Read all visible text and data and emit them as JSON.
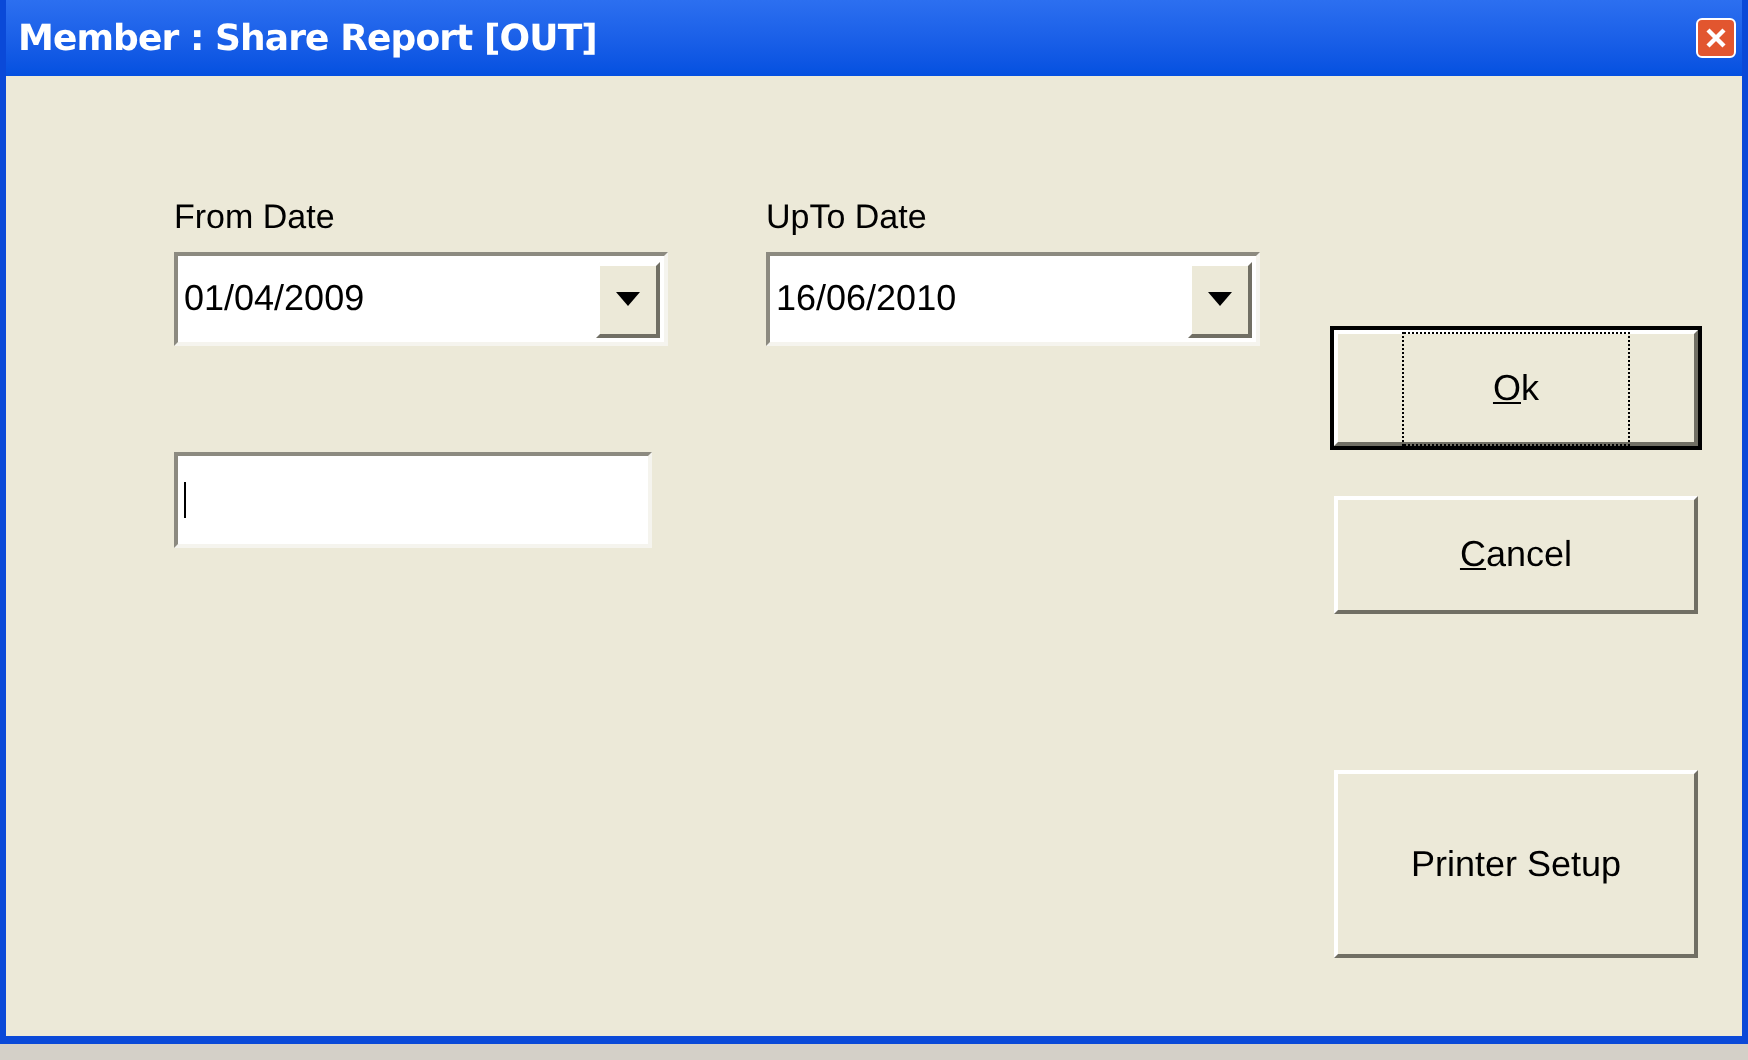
{
  "window": {
    "title": "Member  : Share Report [OUT]"
  },
  "date_fields": [
    {
      "label": "From Date",
      "value": "01/04/2009"
    },
    {
      "label": "UpTo Date",
      "value": "16/06/2010"
    }
  ],
  "text_field": {
    "focused": true
  },
  "buttons": [
    {
      "accel": "O",
      "rest": "k",
      "default": true
    },
    {
      "accel": "C",
      "rest": "ancel",
      "default": false
    },
    {
      "text": "Printer Setup",
      "default": false
    }
  ]
}
